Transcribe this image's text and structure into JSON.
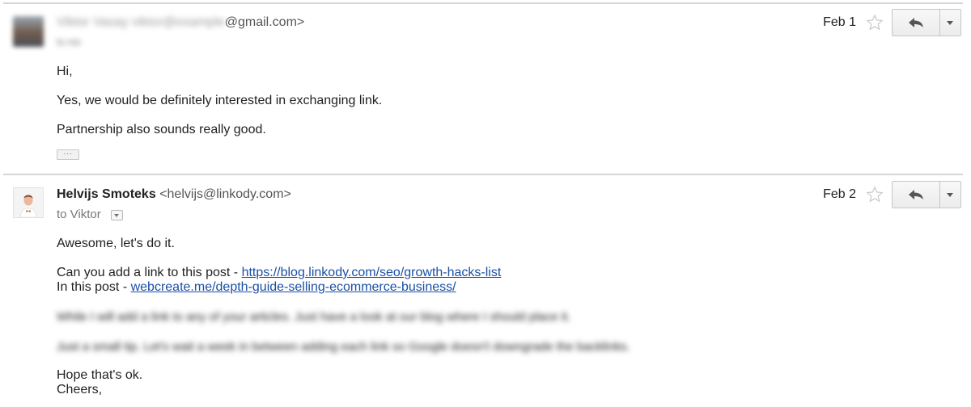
{
  "messages": [
    {
      "sender_name": "Viktor Vasay",
      "sender_email_hidden": "viktor@example",
      "sender_email_visible": "@gmail.com>",
      "recipient": "to me",
      "date": "Feb 1",
      "body": [
        "Hi,",
        "Yes, we would be definitely interested in exchanging link.",
        "Partnership also sounds really good."
      ],
      "trimmed_content": "..."
    },
    {
      "sender_name": "Helvijs Smoteks",
      "sender_email": "<helvijs@linkody.com>",
      "recipient": "to Viktor",
      "date": "Feb 2",
      "greeting": "Awesome, let's do it.",
      "link_line_1_prefix": "Can you add a link to this post - ",
      "link_1": "https://blog.linkody.com/seo/growth-hacks-list",
      "link_line_2_prefix": "In this post - ",
      "link_2": "webcreate.me/depth-guide-selling-ecommerce-business/",
      "blurred_line_1": "While I will add a link to any of your articles. Just have a look at our blog where I should place it.",
      "blurred_line_2": "Just a small tip. Let's wait a week in between adding each link so Google doesn't downgrade the backlinks.",
      "closing_1": "Hope that's ok.",
      "closing_2": "Cheers,"
    }
  ],
  "icons": {
    "star": "star-outline-icon",
    "reply": "reply-arrow-icon",
    "more": "caret-down-icon"
  },
  "colors": {
    "link": "#1a4fa6",
    "divider": "#d5d5d5"
  }
}
